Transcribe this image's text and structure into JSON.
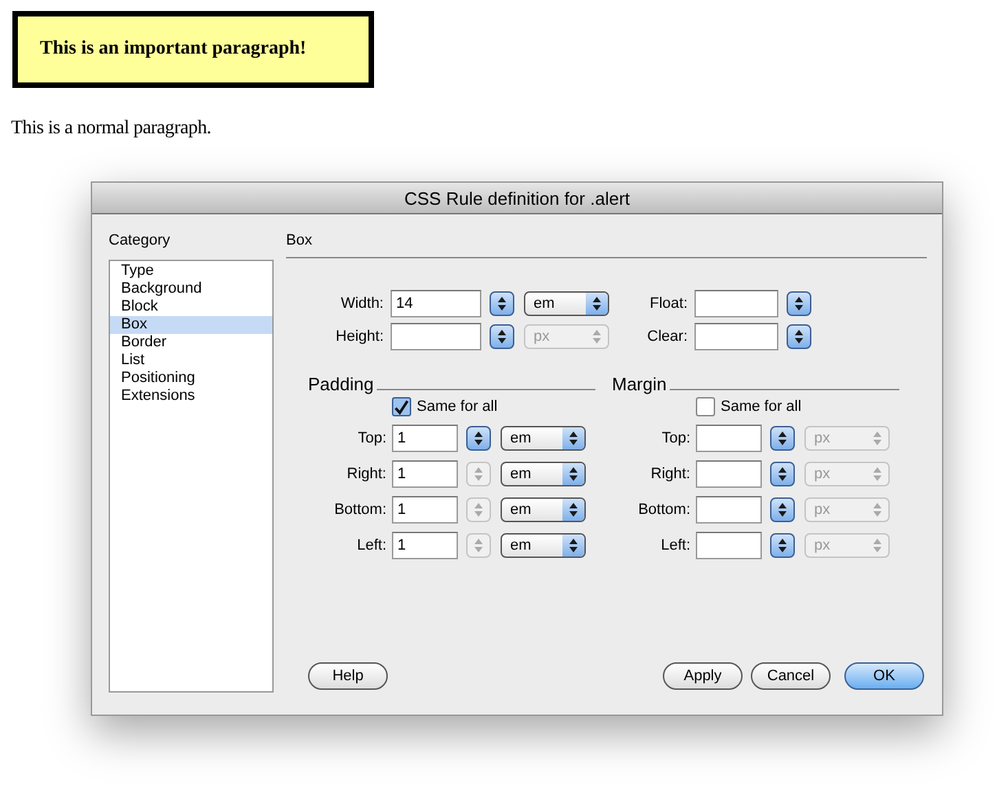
{
  "alert_paragraph": "This is an important paragraph!",
  "normal_paragraph": "This is a normal paragraph.",
  "dialog": {
    "title": "CSS Rule definition for .alert",
    "category_label": "Category",
    "categories": [
      {
        "label": "Type",
        "selected": false
      },
      {
        "label": "Background",
        "selected": false
      },
      {
        "label": "Block",
        "selected": false
      },
      {
        "label": "Box",
        "selected": true
      },
      {
        "label": "Border",
        "selected": false
      },
      {
        "label": "List",
        "selected": false
      },
      {
        "label": "Positioning",
        "selected": false
      },
      {
        "label": "Extensions",
        "selected": false
      }
    ],
    "section_title": "Box",
    "fields": [
      {
        "label": "Width:",
        "value": "14",
        "stepper_disabled": false,
        "unit": {
          "value": "em",
          "disabled": false
        }
      },
      {
        "label": "Float:",
        "stepper_disabled": false
      },
      {
        "label": "Height:",
        "stepper_disabled": false,
        "unit": {
          "value": "px",
          "disabled": true
        }
      },
      {
        "label": "Clear:",
        "stepper_disabled": false
      }
    ],
    "groups": [
      {
        "title": "Padding",
        "same_for_all": {
          "label": "Same for all",
          "checked": true
        },
        "rows": [
          {
            "label": "Top:",
            "value": "1",
            "stepper_disabled": false,
            "unit": {
              "value": "em",
              "disabled": false
            }
          },
          {
            "label": "Right:",
            "value": "1",
            "stepper_disabled": true,
            "unit": {
              "value": "em",
              "disabled": false
            }
          },
          {
            "label": "Bottom:",
            "value": "1",
            "stepper_disabled": true,
            "unit": {
              "value": "em",
              "disabled": false
            }
          },
          {
            "label": "Left:",
            "value": "1",
            "stepper_disabled": true,
            "unit": {
              "value": "em",
              "disabled": false
            }
          }
        ]
      },
      {
        "title": "Margin",
        "same_for_all": {
          "label": "Same for all",
          "checked": false
        },
        "rows": [
          {
            "label": "Top:",
            "stepper_disabled": false,
            "unit": {
              "value": "px",
              "disabled": true
            }
          },
          {
            "label": "Right:",
            "stepper_disabled": false,
            "unit": {
              "value": "px",
              "disabled": true
            }
          },
          {
            "label": "Bottom:",
            "stepper_disabled": false,
            "unit": {
              "value": "px",
              "disabled": true
            }
          },
          {
            "label": "Left:",
            "stepper_disabled": false,
            "unit": {
              "value": "px",
              "disabled": true
            }
          }
        ]
      }
    ],
    "buttons": [
      {
        "label": "Help",
        "kind": "help",
        "default": false
      },
      {
        "label": "Apply",
        "kind": "action",
        "default": false
      },
      {
        "label": "Cancel",
        "kind": "action",
        "default": false
      },
      {
        "label": "OK",
        "kind": "action",
        "default": true
      }
    ]
  }
}
